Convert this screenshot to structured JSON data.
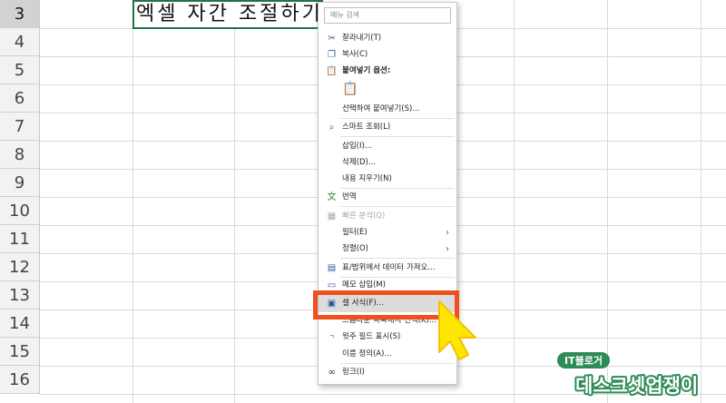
{
  "rows": [
    "3",
    "4",
    "5",
    "6",
    "7",
    "8",
    "9",
    "10",
    "11",
    "12",
    "13",
    "14",
    "15",
    "16"
  ],
  "cell": {
    "text": "엑셀 자간 조절하기"
  },
  "menu": {
    "search_placeholder": "메뉴 검색",
    "items": {
      "cut": "잘라내기(T)",
      "copy": "복사(C)",
      "paste_options": "붙여넣기 옵션:",
      "paste_special": "선택하여 붙여넣기(S)...",
      "smart_lookup": "스마트 조회(L)",
      "insert": "삽입(I)...",
      "delete": "삭제(D)...",
      "clear": "내용 지우기(N)",
      "translate": "번역",
      "quick_analysis": "빠른 분석(Q)",
      "filter": "필터(E)",
      "sort": "정렬(O)",
      "get_data": "표/범위에서 데이터 가져오...",
      "insert_comment": "메모 삽입(M)",
      "format_cells": "셀 서식(F)...",
      "dropdown_pick": "드롭다운 목록에서 선택(K)...",
      "phonetic": "윗주 필드 표시(S)",
      "define_name": "이름 정의(A)...",
      "link": "링크(I)"
    }
  },
  "watermark": {
    "badge": "IT블로거",
    "name": "데스크셋업쟁이"
  },
  "colors": {
    "highlight_box": "#f0501e",
    "cursor": "#ffe600",
    "cell_border": "#217346",
    "badge": "#2e8b57"
  }
}
